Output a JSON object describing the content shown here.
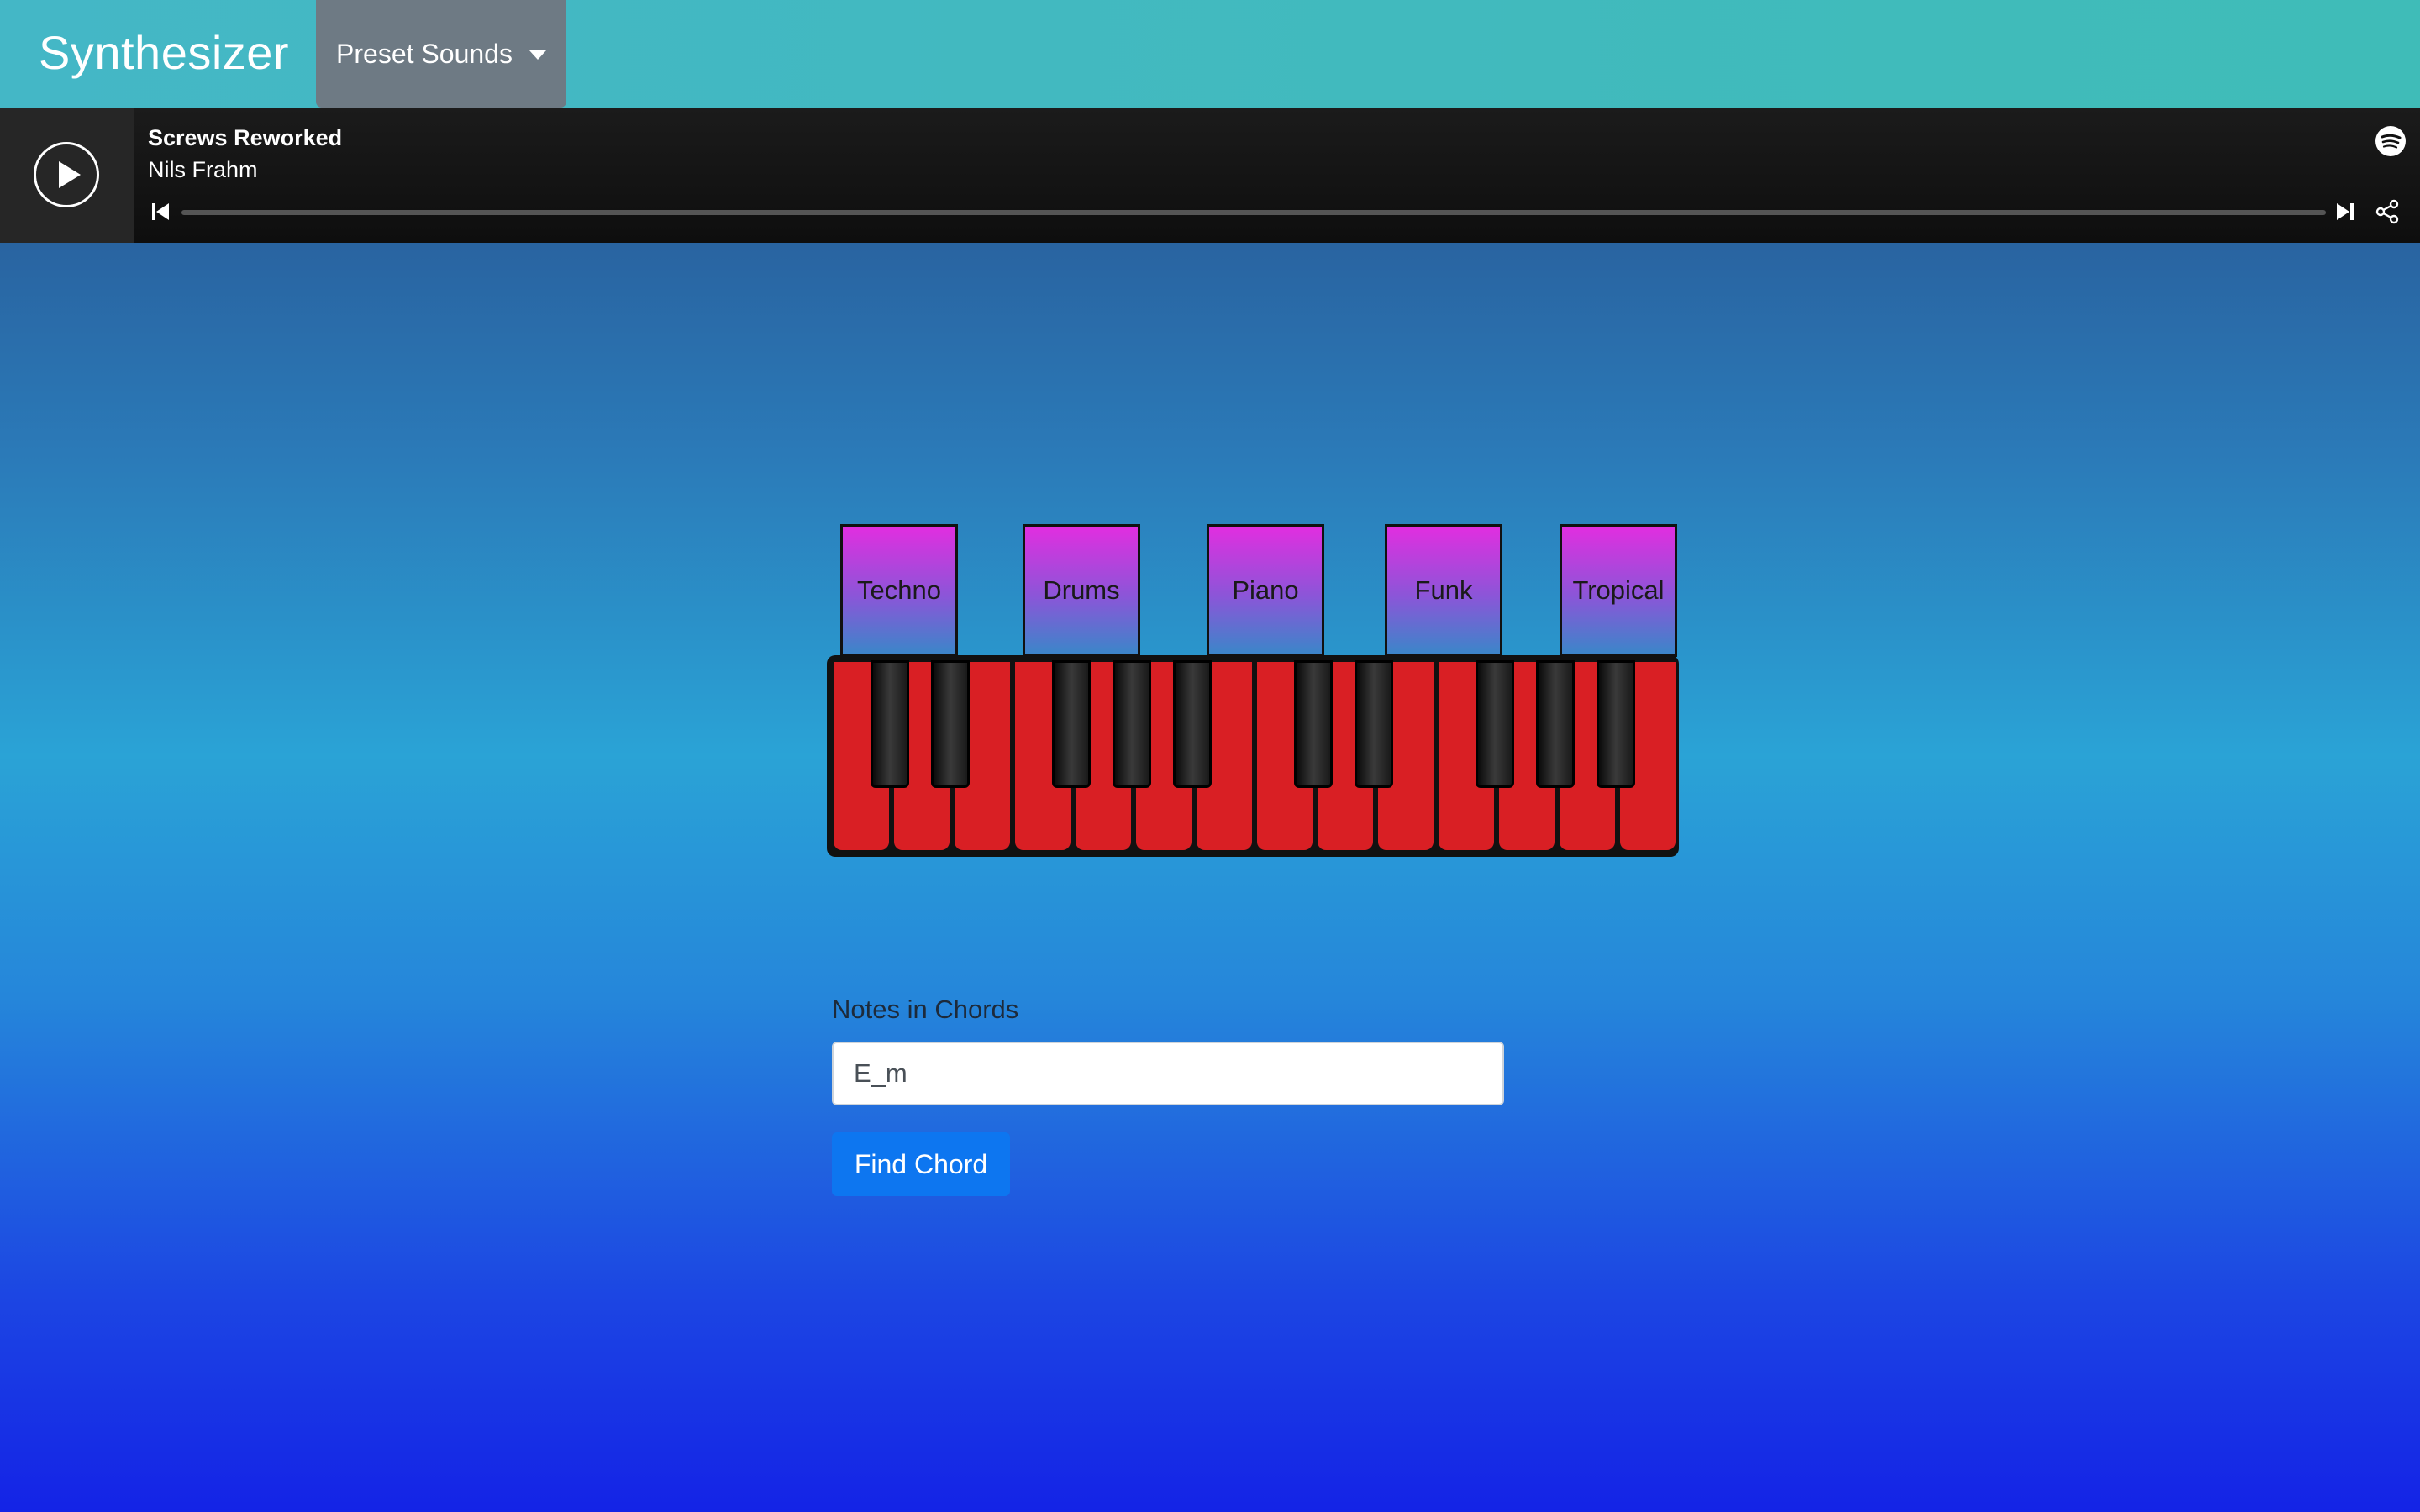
{
  "app": {
    "title": "Synthesizer"
  },
  "navbar": {
    "preset_dropdown_label": "Preset Sounds"
  },
  "player": {
    "track_title": "Screws Reworked",
    "artist": "Nils Frahm",
    "progress": 0.0
  },
  "presets": [
    "Techno",
    "Drums",
    "Piano",
    "Funk",
    "Tropical"
  ],
  "chord_form": {
    "label": "Notes in Chords",
    "input_value": "E_m",
    "button_label": "Find Chord"
  },
  "colors": {
    "accent": "#0d76f0",
    "white_key": "#d91f24",
    "navbar": "#44b7c6"
  },
  "keyboard": {
    "white_keys": 14,
    "black_keys": 10
  }
}
